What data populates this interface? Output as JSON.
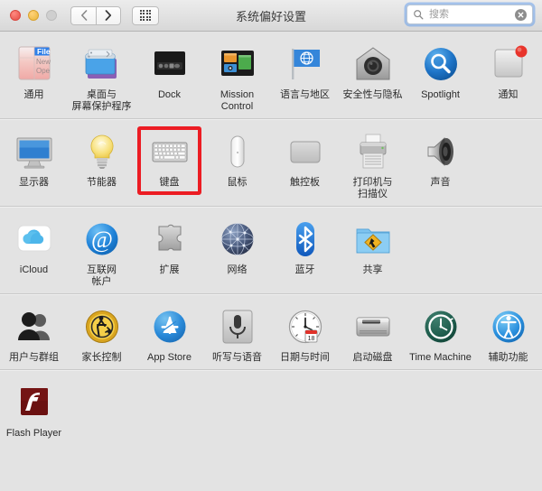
{
  "window": {
    "title": "系统偏好设置",
    "traffic_lights": [
      {
        "name": "close",
        "color": "#ec5f57",
        "enabled": true
      },
      {
        "name": "minimize",
        "color": "#f0bf4c",
        "enabled": true
      },
      {
        "name": "zoom",
        "color": "#cfcfcf",
        "enabled": false
      }
    ],
    "nav": {
      "back_label": "‹",
      "forward_label": "›",
      "grid_label": "show-all"
    }
  },
  "search": {
    "placeholder": "搜索",
    "value": "",
    "icon": "search-icon",
    "clear_icon": "clear-icon",
    "focused": true
  },
  "selection": {
    "selected_item": "键盘",
    "highlight_color": "#ec1c23"
  },
  "rows": [
    {
      "index": 0,
      "items": [
        {
          "id": "general",
          "label": "通用",
          "icon": "general-icon"
        },
        {
          "id": "desktop",
          "label": "桌面与\n屏幕保护程序",
          "icon": "desktop-screensaver-icon"
        },
        {
          "id": "dock",
          "label": "Dock",
          "icon": "dock-icon"
        },
        {
          "id": "mission",
          "label": "Mission\nControl",
          "icon": "mission-control-icon"
        },
        {
          "id": "language",
          "label": "语言与地区",
          "icon": "language-region-icon"
        },
        {
          "id": "security",
          "label": "安全性与隐私",
          "icon": "security-privacy-icon"
        },
        {
          "id": "spotlight",
          "label": "Spotlight",
          "icon": "spotlight-icon"
        },
        {
          "id": "notifications",
          "label": "通知",
          "icon": "notifications-icon"
        }
      ]
    },
    {
      "index": 1,
      "items": [
        {
          "id": "displays",
          "label": "显示器",
          "icon": "displays-icon"
        },
        {
          "id": "energy",
          "label": "节能器",
          "icon": "energy-saver-icon"
        },
        {
          "id": "keyboard",
          "label": "键盘",
          "icon": "keyboard-icon",
          "selected": true
        },
        {
          "id": "mouse",
          "label": "鼠标",
          "icon": "mouse-icon"
        },
        {
          "id": "trackpad",
          "label": "触控板",
          "icon": "trackpad-icon"
        },
        {
          "id": "printers",
          "label": "打印机与\n扫描仪",
          "icon": "printers-scanners-icon"
        },
        {
          "id": "sound",
          "label": "声音",
          "icon": "sound-icon"
        }
      ]
    },
    {
      "index": 2,
      "items": [
        {
          "id": "icloud",
          "label": "iCloud",
          "icon": "icloud-icon"
        },
        {
          "id": "internet",
          "label": "互联网\n帐户",
          "icon": "internet-accounts-icon"
        },
        {
          "id": "extensions",
          "label": "扩展",
          "icon": "extensions-icon"
        },
        {
          "id": "network",
          "label": "网络",
          "icon": "network-icon"
        },
        {
          "id": "bluetooth",
          "label": "蓝牙",
          "icon": "bluetooth-icon"
        },
        {
          "id": "sharing",
          "label": "共享",
          "icon": "sharing-icon"
        }
      ]
    },
    {
      "index": 3,
      "items": [
        {
          "id": "users",
          "label": "用户与群组",
          "icon": "users-groups-icon"
        },
        {
          "id": "parental",
          "label": "家长控制",
          "icon": "parental-controls-icon"
        },
        {
          "id": "appstore",
          "label": "App Store",
          "icon": "app-store-icon"
        },
        {
          "id": "dictation",
          "label": "听写与语音",
          "icon": "dictation-speech-icon"
        },
        {
          "id": "datetime",
          "label": "日期与时间",
          "icon": "date-time-icon"
        },
        {
          "id": "startupdisk",
          "label": "启动磁盘",
          "icon": "startup-disk-icon"
        },
        {
          "id": "timemachine",
          "label": "Time Machine",
          "icon": "time-machine-icon"
        },
        {
          "id": "accessibility",
          "label": "辅助功能",
          "icon": "accessibility-icon"
        }
      ]
    },
    {
      "index": 4,
      "items": [
        {
          "id": "flashplayer",
          "label": "Flash Player",
          "icon": "flash-player-icon"
        }
      ]
    }
  ]
}
